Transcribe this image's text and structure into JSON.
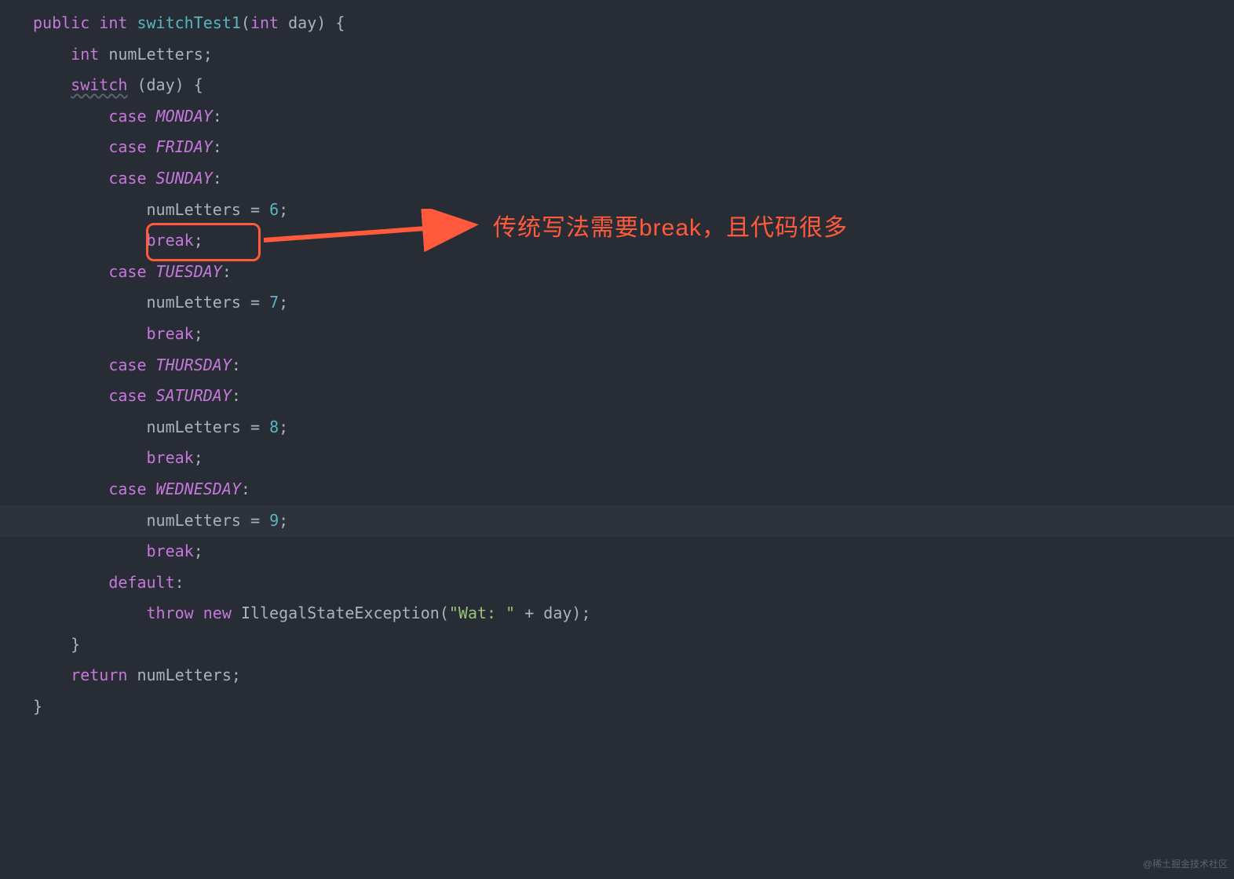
{
  "code": {
    "line1": {
      "kw_public": "public",
      "kw_int": "int",
      "method": "switchTest1",
      "paren_open": "(",
      "param_type": "int",
      "param_name": "day",
      "paren_close": ")",
      "brace_open": "{"
    },
    "line2": {
      "kw_int": "int",
      "var": "numLetters",
      "semi": ";"
    },
    "line3": {
      "kw_switch": "switch",
      "paren_open": "(",
      "var": "day",
      "paren_close": ")",
      "brace_open": "{"
    },
    "case1": {
      "kw": "case",
      "const": "MONDAY",
      "colon": ":"
    },
    "case2": {
      "kw": "case",
      "const": "FRIDAY",
      "colon": ":"
    },
    "case3": {
      "kw": "case",
      "const": "SUNDAY",
      "colon": ":"
    },
    "body1": {
      "var": "numLetters",
      "eq": "=",
      "num": "6",
      "semi": ";"
    },
    "break1": {
      "kw": "break",
      "semi": ";"
    },
    "case4": {
      "kw": "case",
      "const": "TUESDAY",
      "colon": ":"
    },
    "body2": {
      "var": "numLetters",
      "eq": "=",
      "num": "7",
      "semi": ";"
    },
    "break2": {
      "kw": "break",
      "semi": ";"
    },
    "case5": {
      "kw": "case",
      "const": "THURSDAY",
      "colon": ":"
    },
    "case6": {
      "kw": "case",
      "const": "SATURDAY",
      "colon": ":"
    },
    "body3": {
      "var": "numLetters",
      "eq": "=",
      "num": "8",
      "semi": ";"
    },
    "break3": {
      "kw": "break",
      "semi": ";"
    },
    "case7": {
      "kw": "case",
      "const": "WEDNESDAY",
      "colon": ":"
    },
    "body4": {
      "var": "numLetters",
      "eq": "=",
      "num": "9",
      "semi": ";"
    },
    "break4": {
      "kw": "break",
      "semi": ";"
    },
    "default": {
      "kw": "default",
      "colon": ":"
    },
    "throw": {
      "kw_throw": "throw",
      "kw_new": "new",
      "cls": "IllegalStateException",
      "paren_open": "(",
      "str": "\"Wat: \"",
      "plus": "+",
      "var": "day",
      "paren_close": ")",
      "semi": ";"
    },
    "close1": {
      "brace": "}"
    },
    "return": {
      "kw": "return",
      "var": "numLetters",
      "semi": ";"
    },
    "close2": {
      "brace": "}"
    }
  },
  "annotation": {
    "text": "传统写法需要break，且代码很多",
    "box_target": "break"
  },
  "watermark": "@稀土掘金技术社区"
}
